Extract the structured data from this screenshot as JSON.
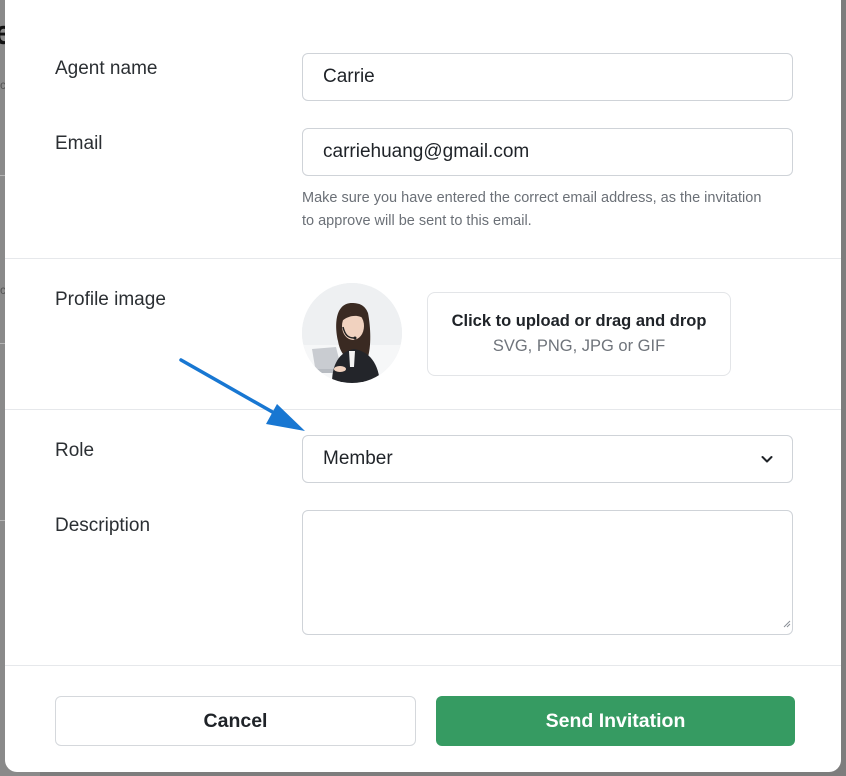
{
  "background": {
    "glyph": "e",
    "snippets": [
      "c",
      "c"
    ]
  },
  "form": {
    "agent_name": {
      "label": "Agent name",
      "value": "Carrie"
    },
    "email": {
      "label": "Email",
      "value": "carriehuang@gmail.com",
      "hint": "Make sure you have entered the correct email address, as the invitation to approve will be sent to this email."
    },
    "profile_image": {
      "label": "Profile image",
      "upload_title": "Click to upload or drag and drop",
      "upload_formats": "SVG, PNG, JPG or GIF"
    },
    "role": {
      "label": "Role",
      "selected": "Member"
    },
    "description": {
      "label": "Description",
      "value": ""
    }
  },
  "actions": {
    "cancel_label": "Cancel",
    "send_label": "Send Invitation"
  },
  "colors": {
    "primary": "#369b62",
    "annotation_arrow": "#1877d2",
    "overlay": "#7d7d7d"
  },
  "icons": {
    "select": "chevron-down-icon",
    "annotation": "pointer-arrow-icon"
  }
}
